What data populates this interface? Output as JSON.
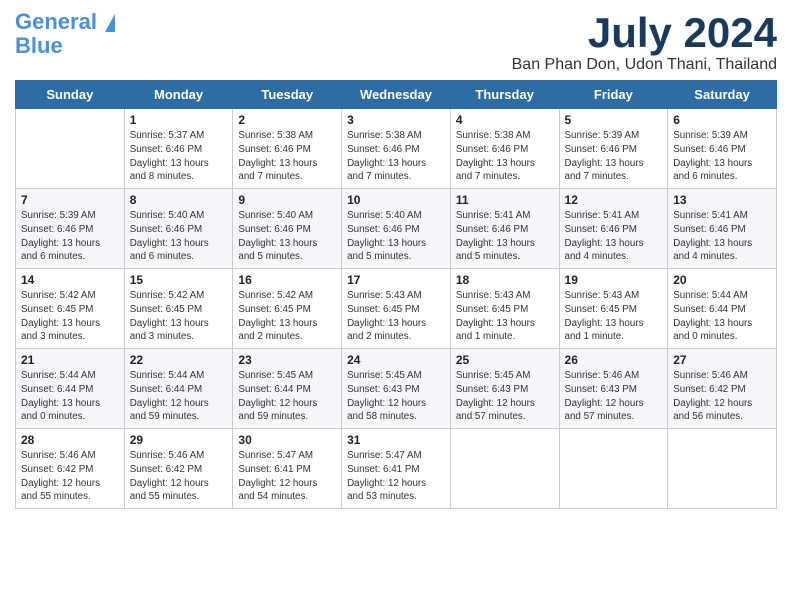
{
  "header": {
    "logo_line1": "General",
    "logo_line2": "Blue",
    "month": "July 2024",
    "location": "Ban Phan Don, Udon Thani, Thailand"
  },
  "weekdays": [
    "Sunday",
    "Monday",
    "Tuesday",
    "Wednesday",
    "Thursday",
    "Friday",
    "Saturday"
  ],
  "weeks": [
    [
      {
        "day": "",
        "info": ""
      },
      {
        "day": "1",
        "info": "Sunrise: 5:37 AM\nSunset: 6:46 PM\nDaylight: 13 hours\nand 8 minutes."
      },
      {
        "day": "2",
        "info": "Sunrise: 5:38 AM\nSunset: 6:46 PM\nDaylight: 13 hours\nand 7 minutes."
      },
      {
        "day": "3",
        "info": "Sunrise: 5:38 AM\nSunset: 6:46 PM\nDaylight: 13 hours\nand 7 minutes."
      },
      {
        "day": "4",
        "info": "Sunrise: 5:38 AM\nSunset: 6:46 PM\nDaylight: 13 hours\nand 7 minutes."
      },
      {
        "day": "5",
        "info": "Sunrise: 5:39 AM\nSunset: 6:46 PM\nDaylight: 13 hours\nand 7 minutes."
      },
      {
        "day": "6",
        "info": "Sunrise: 5:39 AM\nSunset: 6:46 PM\nDaylight: 13 hours\nand 6 minutes."
      }
    ],
    [
      {
        "day": "7",
        "info": "Sunrise: 5:39 AM\nSunset: 6:46 PM\nDaylight: 13 hours\nand 6 minutes."
      },
      {
        "day": "8",
        "info": "Sunrise: 5:40 AM\nSunset: 6:46 PM\nDaylight: 13 hours\nand 6 minutes."
      },
      {
        "day": "9",
        "info": "Sunrise: 5:40 AM\nSunset: 6:46 PM\nDaylight: 13 hours\nand 5 minutes."
      },
      {
        "day": "10",
        "info": "Sunrise: 5:40 AM\nSunset: 6:46 PM\nDaylight: 13 hours\nand 5 minutes."
      },
      {
        "day": "11",
        "info": "Sunrise: 5:41 AM\nSunset: 6:46 PM\nDaylight: 13 hours\nand 5 minutes."
      },
      {
        "day": "12",
        "info": "Sunrise: 5:41 AM\nSunset: 6:46 PM\nDaylight: 13 hours\nand 4 minutes."
      },
      {
        "day": "13",
        "info": "Sunrise: 5:41 AM\nSunset: 6:46 PM\nDaylight: 13 hours\nand 4 minutes."
      }
    ],
    [
      {
        "day": "14",
        "info": "Sunrise: 5:42 AM\nSunset: 6:45 PM\nDaylight: 13 hours\nand 3 minutes."
      },
      {
        "day": "15",
        "info": "Sunrise: 5:42 AM\nSunset: 6:45 PM\nDaylight: 13 hours\nand 3 minutes."
      },
      {
        "day": "16",
        "info": "Sunrise: 5:42 AM\nSunset: 6:45 PM\nDaylight: 13 hours\nand 2 minutes."
      },
      {
        "day": "17",
        "info": "Sunrise: 5:43 AM\nSunset: 6:45 PM\nDaylight: 13 hours\nand 2 minutes."
      },
      {
        "day": "18",
        "info": "Sunrise: 5:43 AM\nSunset: 6:45 PM\nDaylight: 13 hours\nand 1 minute."
      },
      {
        "day": "19",
        "info": "Sunrise: 5:43 AM\nSunset: 6:45 PM\nDaylight: 13 hours\nand 1 minute."
      },
      {
        "day": "20",
        "info": "Sunrise: 5:44 AM\nSunset: 6:44 PM\nDaylight: 13 hours\nand 0 minutes."
      }
    ],
    [
      {
        "day": "21",
        "info": "Sunrise: 5:44 AM\nSunset: 6:44 PM\nDaylight: 13 hours\nand 0 minutes."
      },
      {
        "day": "22",
        "info": "Sunrise: 5:44 AM\nSunset: 6:44 PM\nDaylight: 12 hours\nand 59 minutes."
      },
      {
        "day": "23",
        "info": "Sunrise: 5:45 AM\nSunset: 6:44 PM\nDaylight: 12 hours\nand 59 minutes."
      },
      {
        "day": "24",
        "info": "Sunrise: 5:45 AM\nSunset: 6:43 PM\nDaylight: 12 hours\nand 58 minutes."
      },
      {
        "day": "25",
        "info": "Sunrise: 5:45 AM\nSunset: 6:43 PM\nDaylight: 12 hours\nand 57 minutes."
      },
      {
        "day": "26",
        "info": "Sunrise: 5:46 AM\nSunset: 6:43 PM\nDaylight: 12 hours\nand 57 minutes."
      },
      {
        "day": "27",
        "info": "Sunrise: 5:46 AM\nSunset: 6:42 PM\nDaylight: 12 hours\nand 56 minutes."
      }
    ],
    [
      {
        "day": "28",
        "info": "Sunrise: 5:46 AM\nSunset: 6:42 PM\nDaylight: 12 hours\nand 55 minutes."
      },
      {
        "day": "29",
        "info": "Sunrise: 5:46 AM\nSunset: 6:42 PM\nDaylight: 12 hours\nand 55 minutes."
      },
      {
        "day": "30",
        "info": "Sunrise: 5:47 AM\nSunset: 6:41 PM\nDaylight: 12 hours\nand 54 minutes."
      },
      {
        "day": "31",
        "info": "Sunrise: 5:47 AM\nSunset: 6:41 PM\nDaylight: 12 hours\nand 53 minutes."
      },
      {
        "day": "",
        "info": ""
      },
      {
        "day": "",
        "info": ""
      },
      {
        "day": "",
        "info": ""
      }
    ]
  ]
}
